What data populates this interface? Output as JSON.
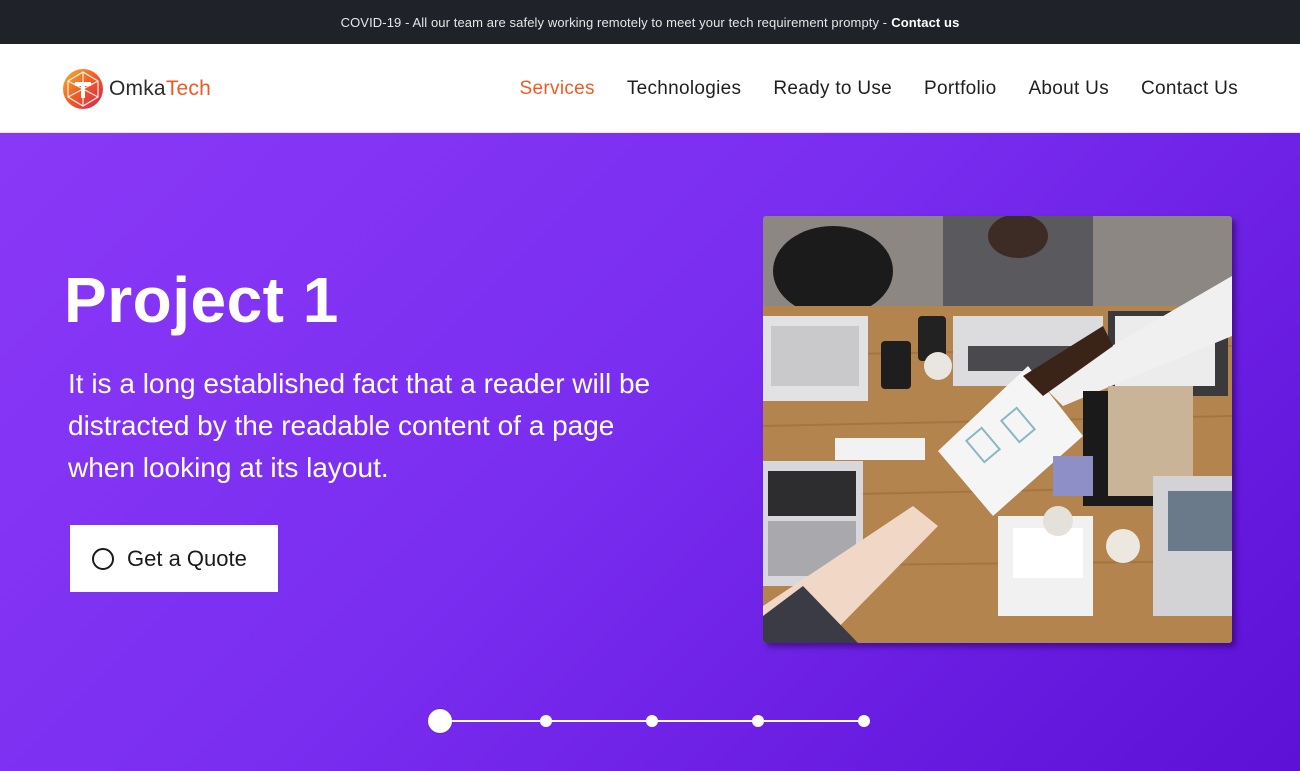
{
  "topbar": {
    "notice": "COVID-19 - All our team are safely working remotely to meet your tech requirement prompty - ",
    "link": "Contact us"
  },
  "logo": {
    "part1": "Omka",
    "part2": "Tech",
    "icon": "gem-logo-icon"
  },
  "nav": {
    "items": [
      "Services",
      "Technologies",
      "Ready to Use",
      "Portfolio",
      "About Us",
      "Contact Us"
    ],
    "active": "Services"
  },
  "hero": {
    "title": "Project 1",
    "text": "It is a long established fact that a reader will be distracted by the readable content of a page when looking at its layout.",
    "button": "Get a Quote",
    "slides_total": 5,
    "active_slide": 1
  },
  "colors": {
    "accent": "#ef5a24",
    "topbar_bg": "#1f2329",
    "hero_gradient_start": "#8a38f7",
    "hero_gradient_end": "#5d10d6"
  }
}
